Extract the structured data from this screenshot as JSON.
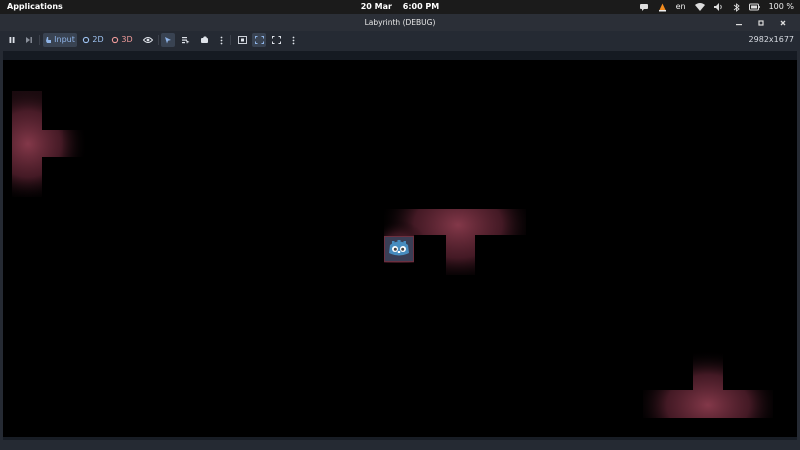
{
  "system_bar": {
    "apps_label": "Applications",
    "date": "20 Mar",
    "time": "6:00 PM",
    "keyboard_layout": "en",
    "battery_percent": "100 %",
    "icons": [
      "chat-icon",
      "vlc-icon",
      "wifi-icon",
      "volume-icon",
      "bluetooth-icon",
      "battery-icon"
    ]
  },
  "window": {
    "title": "Labyrinth (DEBUG)",
    "buttons": [
      "minimize",
      "maximize",
      "close"
    ]
  },
  "toolbar": {
    "input_label": "Input",
    "mode_2d_label": "2D",
    "mode_3d_label": "3D",
    "resolution": "2982x1677",
    "accent_input": "#8fb4e8",
    "accent_2d": "#9ec3f2",
    "accent_3d": "#f09b9b"
  },
  "scene": {
    "background": "#000000",
    "light_color": "#8a3b4d",
    "player_icon": "godot-robot-icon"
  }
}
